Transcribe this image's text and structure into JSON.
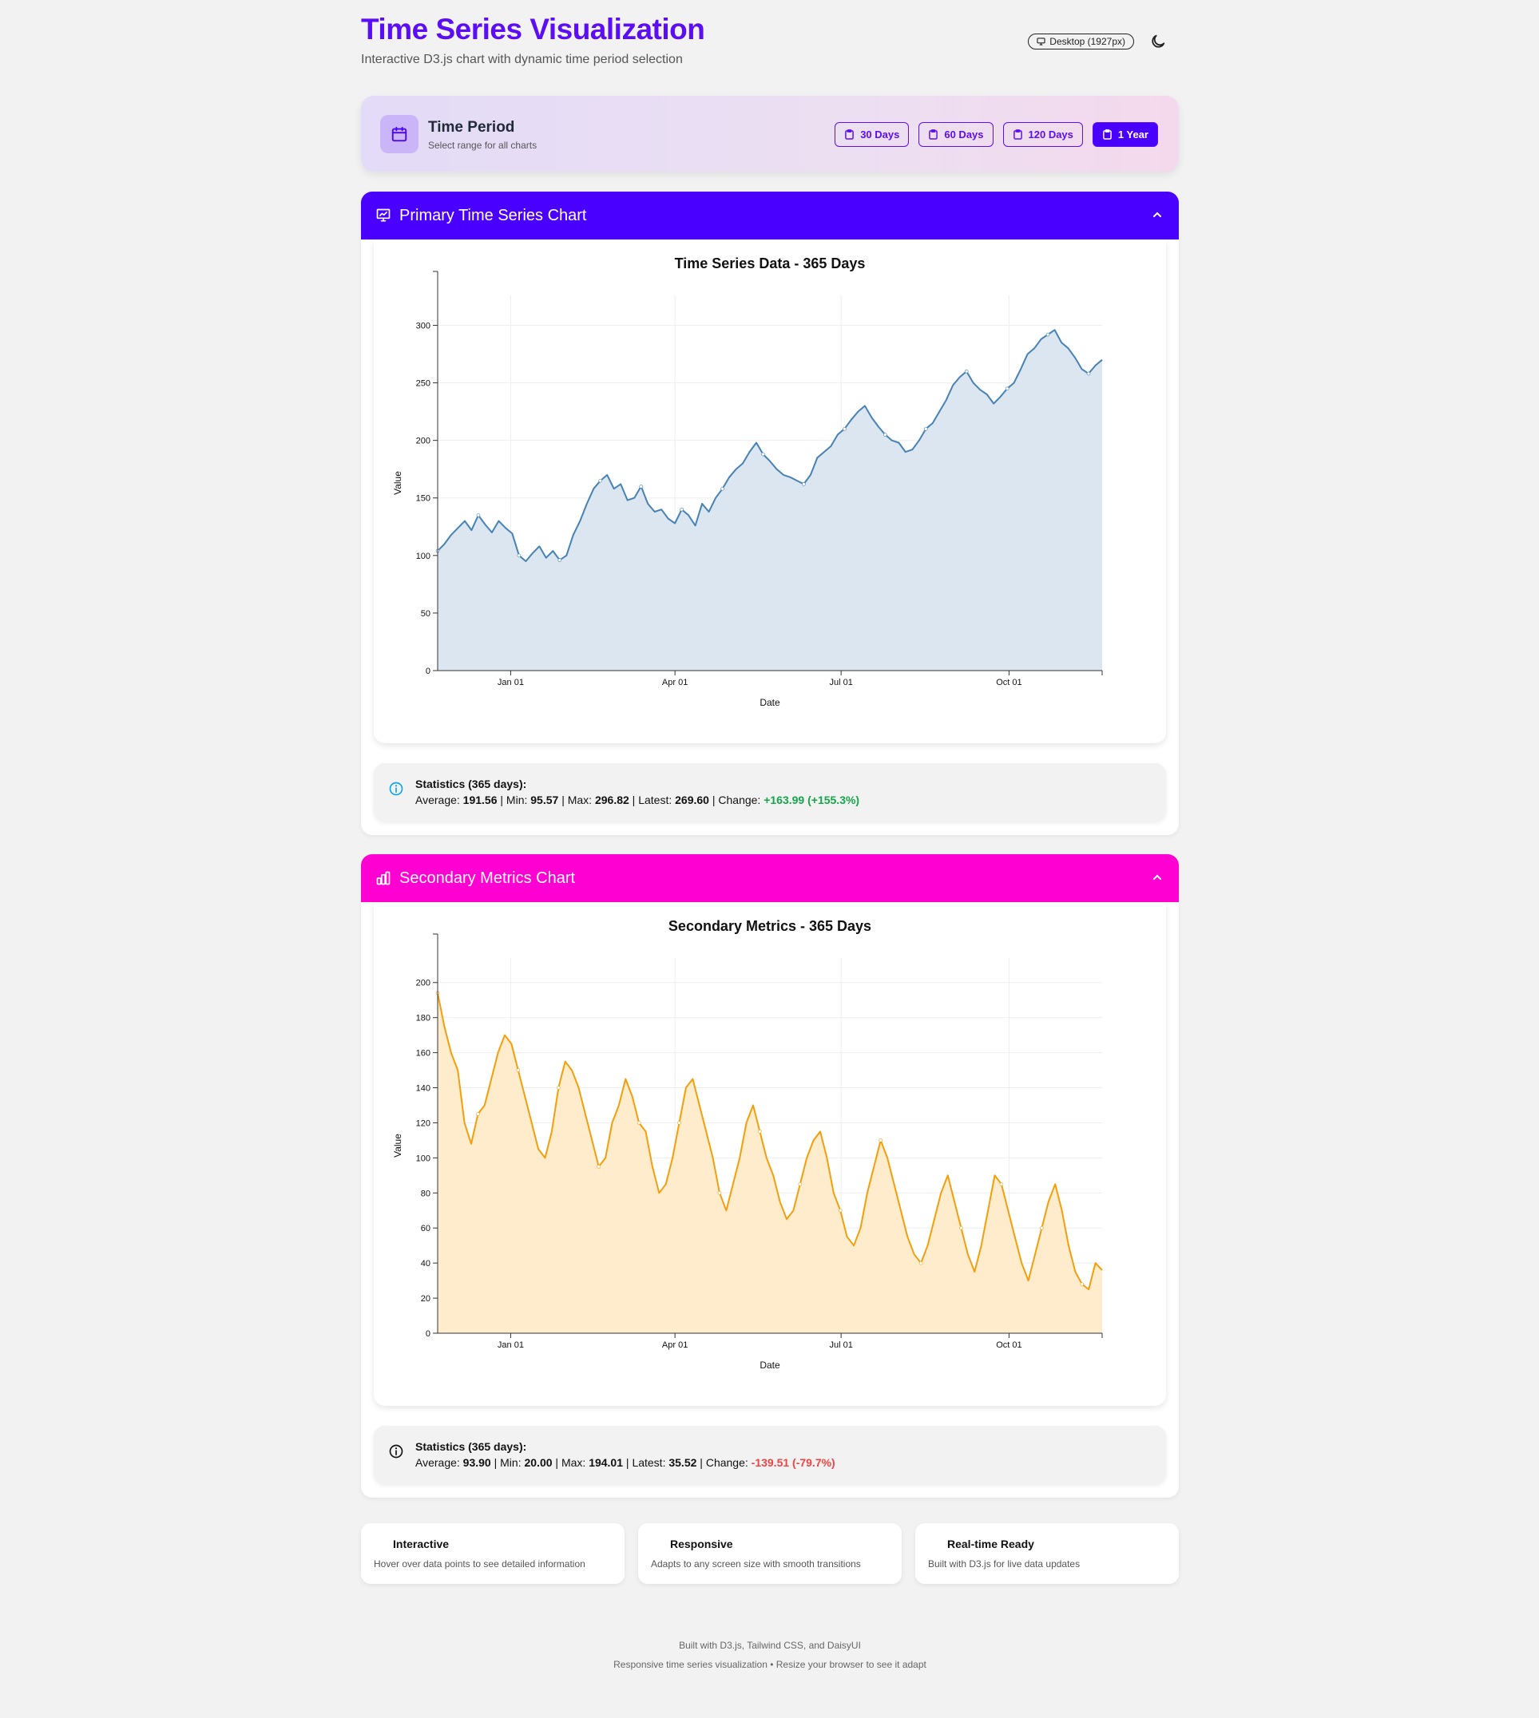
{
  "header": {
    "title": "Time Series Visualization",
    "subtitle": "Interactive D3.js chart with dynamic time period selection",
    "device_badge": "Desktop (1927px)"
  },
  "period": {
    "title": "Time Period",
    "subtitle": "Select range for all charts",
    "buttons": [
      {
        "label": "30 Days",
        "active": false
      },
      {
        "label": "60 Days",
        "active": false
      },
      {
        "label": "120 Days",
        "active": false
      },
      {
        "label": "1 Year",
        "active": true
      }
    ]
  },
  "primary": {
    "header": "Primary Time Series Chart",
    "header_color": "#4a00ff",
    "stats": {
      "title": "Statistics (365 days):",
      "average_label": "Average:",
      "average": "191.56",
      "min_label": "Min:",
      "min": "95.57",
      "max_label": "Max:",
      "max": "296.82",
      "latest_label": "Latest:",
      "latest": "269.60",
      "change_label": "Change:",
      "change": "+163.99 (+155.3%)"
    }
  },
  "secondary": {
    "header": "Secondary Metrics Chart",
    "header_color": "#ff00d3",
    "stats": {
      "title": "Statistics (365 days):",
      "average_label": "Average:",
      "average": "93.90",
      "min_label": "Min:",
      "min": "20.00",
      "max_label": "Max:",
      "max": "194.01",
      "latest_label": "Latest:",
      "latest": "35.52",
      "change_label": "Change:",
      "change": "-139.51 (-79.7%)"
    }
  },
  "features": [
    {
      "title": "Interactive",
      "desc": "Hover over data points to see detailed information"
    },
    {
      "title": "Responsive",
      "desc": "Adapts to any screen size with smooth transitions"
    },
    {
      "title": "Real-time Ready",
      "desc": "Built with D3.js for live data updates"
    }
  ],
  "footer": {
    "line1": "Built with D3.js, Tailwind CSS, and DaisyUI",
    "line2": "Responsive time series visualization • Resize your browser to see it adapt"
  },
  "chart_data": [
    {
      "type": "area",
      "title": "Time Series Data - 365 Days",
      "xlabel": "Date",
      "ylabel": "Value",
      "ylim": [
        0,
        326
      ],
      "yticks": [
        0,
        50,
        100,
        150,
        200,
        250,
        300
      ],
      "xticks": [
        "Jan 01",
        "Apr 01",
        "Jul 01",
        "Oct 01"
      ],
      "line_color": "#4682b4",
      "fill_color": "#dce6f0",
      "grid": true,
      "series": [
        {
          "x_start": "Nov 22",
          "x_end": "Nov 21",
          "values": [
            104,
            110,
            118,
            124,
            130,
            122,
            135,
            127,
            120,
            130,
            124,
            119,
            100,
            95,
            102,
            108,
            98,
            104,
            96,
            100,
            118,
            130,
            145,
            158,
            165,
            170,
            158,
            162,
            148,
            150,
            160,
            145,
            138,
            140,
            132,
            128,
            140,
            135,
            126,
            145,
            138,
            150,
            158,
            168,
            175,
            180,
            190,
            198,
            188,
            182,
            175,
            170,
            168,
            165,
            162,
            170,
            185,
            190,
            195,
            205,
            210,
            218,
            225,
            230,
            220,
            212,
            205,
            200,
            198,
            190,
            192,
            200,
            210,
            215,
            225,
            235,
            248,
            255,
            260,
            250,
            244,
            240,
            232,
            238,
            245,
            250,
            262,
            275,
            280,
            288,
            292,
            296,
            285,
            280,
            272,
            262,
            258,
            265,
            270
          ]
        }
      ]
    },
    {
      "type": "area",
      "title": "Secondary Metrics - 365 Days",
      "xlabel": "Date",
      "ylabel": "Value",
      "ylim": [
        0,
        214
      ],
      "yticks": [
        0,
        20,
        40,
        60,
        80,
        100,
        120,
        140,
        160,
        180,
        200
      ],
      "xticks": [
        "Jan 01",
        "Apr 01",
        "Jul 01",
        "Oct 01"
      ],
      "line_color": "#f59e0b",
      "fill_color": "#feeccc",
      "grid": true,
      "series": [
        {
          "x_start": "Nov 22",
          "x_end": "Nov 21",
          "values": [
            194,
            175,
            160,
            150,
            120,
            108,
            125,
            130,
            145,
            160,
            170,
            165,
            150,
            135,
            120,
            105,
            100,
            115,
            140,
            155,
            150,
            140,
            125,
            110,
            95,
            100,
            120,
            130,
            145,
            135,
            120,
            115,
            95,
            80,
            85,
            100,
            120,
            140,
            145,
            130,
            115,
            100,
            80,
            70,
            85,
            100,
            120,
            130,
            115,
            100,
            90,
            75,
            65,
            70,
            85,
            100,
            110,
            115,
            100,
            80,
            70,
            55,
            50,
            60,
            80,
            95,
            110,
            100,
            85,
            70,
            55,
            45,
            40,
            50,
            65,
            80,
            90,
            75,
            60,
            45,
            35,
            50,
            70,
            90,
            85,
            70,
            55,
            40,
            30,
            45,
            60,
            75,
            85,
            70,
            50,
            35,
            28,
            25,
            40,
            36
          ]
        }
      ]
    }
  ]
}
